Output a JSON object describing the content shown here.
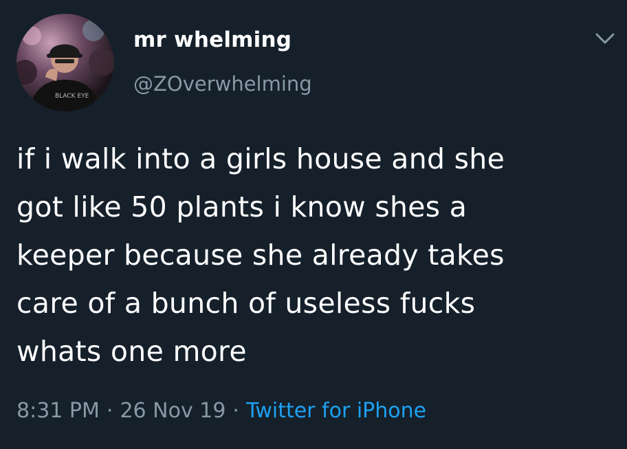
{
  "author": {
    "display_name": "mr whelming",
    "handle": "@ZOverwhelming"
  },
  "tweet": {
    "text": "if i walk into a girls house and she\ngot like 50 plants i know shes a\nkeeper because she already takes\ncare of a bunch of useless fucks\nwhats one more",
    "time": "8:31 PM",
    "date": "26 Nov 19",
    "source": "Twitter for iPhone",
    "separator": "·"
  },
  "icons": {
    "menu": "chevron-down-icon"
  },
  "colors": {
    "background": "#15202b",
    "primary_text": "#ffffff",
    "secondary_text": "#8899a6",
    "link": "#1da1f2"
  }
}
